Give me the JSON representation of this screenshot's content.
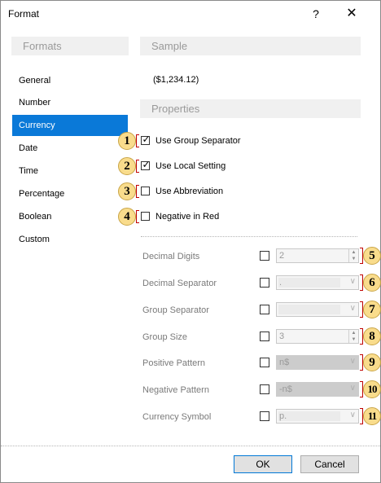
{
  "window": {
    "title": "Format",
    "help_label": "?",
    "close_label": "✕"
  },
  "formats": {
    "header": "Formats",
    "items": [
      "General",
      "Number",
      "Currency",
      "Date",
      "Time",
      "Percentage",
      "Boolean",
      "Custom"
    ],
    "selected": "Currency"
  },
  "sample": {
    "header": "Sample",
    "value": "($1,234.12)"
  },
  "properties": {
    "header": "Properties",
    "options": [
      {
        "badge": "1",
        "label": "Use Group Separator",
        "checked": true
      },
      {
        "badge": "2",
        "label": "Use Local Setting",
        "checked": true
      },
      {
        "badge": "3",
        "label": "Use Abbreviation",
        "checked": false
      },
      {
        "badge": "4",
        "label": "Negative in Red",
        "checked": false
      }
    ],
    "fields": [
      {
        "badge": "5",
        "label": "Decimal Digits",
        "value": "2",
        "control": "spin"
      },
      {
        "badge": "6",
        "label": "Decimal Separator",
        "value": ".",
        "control": "combo"
      },
      {
        "badge": "7",
        "label": "Group Separator",
        "value": "",
        "control": "combo"
      },
      {
        "badge": "8",
        "label": "Group Size",
        "value": "3",
        "control": "spin"
      },
      {
        "badge": "9",
        "label": "Positive Pattern",
        "value": "n$",
        "control": "combo-disabled"
      },
      {
        "badge": "10",
        "label": "Negative Pattern",
        "value": "-n$",
        "control": "combo-disabled"
      },
      {
        "badge": "11",
        "label": "Currency Symbol",
        "value": "р.",
        "control": "combo"
      }
    ]
  },
  "buttons": {
    "ok": "OK",
    "cancel": "Cancel"
  },
  "colors": {
    "selection": "#0a79d8",
    "badge_fill": "#f9dc8c",
    "bracket": "#c00000"
  }
}
